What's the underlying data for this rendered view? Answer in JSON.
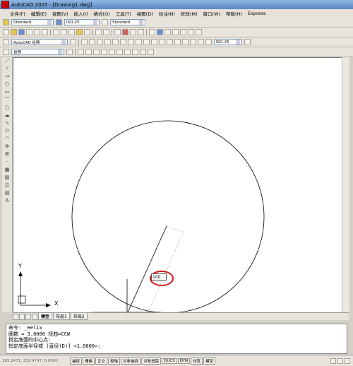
{
  "window": {
    "title": "AutoCAD 2007 - [Drawing1.dwg]"
  },
  "menu": [
    "文件(F)",
    "编辑(E)",
    "视图(V)",
    "插入(I)",
    "格式(O)",
    "工具(T)",
    "绘图(D)",
    "标注(N)",
    "修改(M)",
    "窗口(W)",
    "帮助(H)",
    "Express"
  ],
  "toolbar": {
    "text_style": "Standard",
    "dim_style": "ISO-25",
    "table_style": "Standard",
    "workspace": "AutoCAD 经典",
    "layer": "0",
    "ucs": "世界",
    "dim_style_2": "ISO-25"
  },
  "drawing": {
    "dimension_input": "100",
    "ucs_x": "X",
    "ucs_y": "Y"
  },
  "tabs": [
    "模型",
    "布局1",
    "布局2"
  ],
  "command_lines": [
    "命令: _Helix",
    "圈数 = 3.0000      扭曲=CCW",
    "指定底面的中心点:",
    "指定底面半径或 [直径(D)] <1.0000>:"
  ],
  "status": {
    "coords": "385.2471, 319.4747, 0.0000",
    "buttons": [
      "捕捉",
      "栅格",
      "正交",
      "极轴",
      "对象捕捉",
      "对象追踪",
      "DUCS",
      "DYN",
      "线宽",
      "模型"
    ]
  }
}
